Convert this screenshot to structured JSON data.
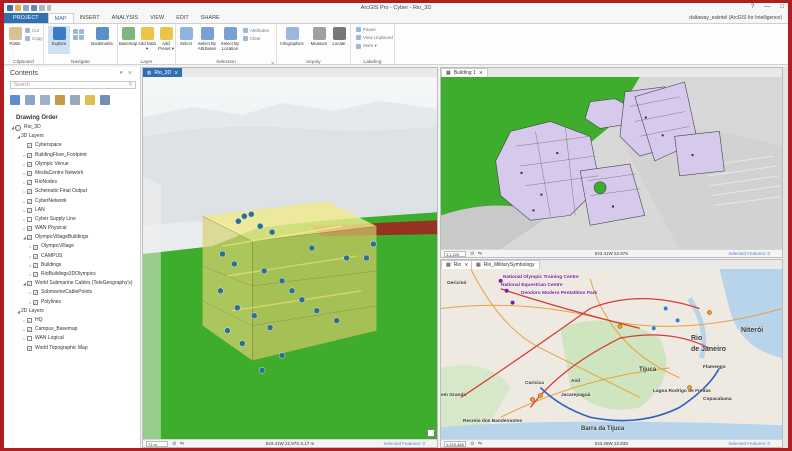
{
  "window": {
    "title": "ArcGIS Pro - Cyber - Rio_3D",
    "controls": [
      "?",
      "—",
      "□"
    ]
  },
  "quick_access": [
    "save-icon",
    "open-icon",
    "new-icon",
    "undo-icon",
    "redo-icon",
    "customize-icon"
  ],
  "ribbon_tabs": [
    "PROJECT",
    "MAP",
    "INSERT",
    "ANALYSIS",
    "VIEW",
    "EDIT",
    "SHARE"
  ],
  "active_tab": "MAP",
  "signin": "daltaway_esiintel (ArcGIS for Intelligence)",
  "ribbon": {
    "clipboard": {
      "name": "Clipboard",
      "paste": "Paste",
      "cut": "Cut",
      "copy": "Copy"
    },
    "navigate": {
      "name": "Navigate",
      "explore": "Explore",
      "bookmarks": "Bookmarks"
    },
    "layer": {
      "name": "Layer",
      "basemap": "Basemap",
      "add_data": "Add Data ▾",
      "add_preset": "Add Preset ▾"
    },
    "selection": {
      "name": "Selection",
      "select": "Select",
      "by_attributes": "Select By Attributes",
      "by_location": "Select By Location",
      "attributes": "Attributes",
      "clear": "Clear"
    },
    "inquiry": {
      "name": "Inquiry",
      "infographics": "Infographics",
      "measure": "Measure",
      "locate": "Locate"
    },
    "labeling": {
      "name": "Labeling",
      "pause": "Pause",
      "view_unplaced": "View Unplaced",
      "more": "More ▾"
    }
  },
  "contents": {
    "title": "Contents",
    "pin": "▾ ⨯",
    "search_placeholder": "Search",
    "drawing_order": "Drawing Order",
    "items": [
      {
        "label": "Rio_3D",
        "level": 0,
        "kind": "scene",
        "expand": "◢"
      },
      {
        "label": "3D Layers",
        "level": 1,
        "kind": "group",
        "expand": "◢"
      },
      {
        "label": "Cyberspace",
        "level": 2,
        "checked": true
      },
      {
        "label": "BuildingFloor_Footprint",
        "level": 2,
        "checked": true,
        "expand": "▹"
      },
      {
        "label": "Olympic Venue",
        "level": 2,
        "checked": true,
        "expand": "▹"
      },
      {
        "label": "MediaCentre Network",
        "level": 2,
        "checked": true,
        "expand": "▹"
      },
      {
        "label": "RioNodes",
        "level": 2,
        "checked": true,
        "expand": "▹"
      },
      {
        "label": "Schematic Final Output",
        "level": 2,
        "checked": true,
        "expand": "▹"
      },
      {
        "label": "CyberNetwork",
        "level": 2,
        "checked": true,
        "expand": "▹"
      },
      {
        "label": "LAN",
        "level": 2,
        "checked": true,
        "expand": "▹"
      },
      {
        "label": "Cyber Supply Line",
        "level": 2,
        "checked": false,
        "expand": "▹"
      },
      {
        "label": "WAN Physical",
        "level": 2,
        "checked": true,
        "expand": "▹"
      },
      {
        "label": "OlympicVillageBuildings",
        "level": 2,
        "checked": true,
        "expand": "◢"
      },
      {
        "label": "OlympicVillage",
        "level": 3,
        "checked": true,
        "expand": "▹"
      },
      {
        "label": "CAMPUS",
        "level": 3,
        "checked": true,
        "expand": "▹"
      },
      {
        "label": "Buildings",
        "level": 3,
        "checked": true,
        "expand": "▹"
      },
      {
        "label": "RioBuildings3DOlympics",
        "level": 3,
        "checked": true,
        "expand": "▹"
      },
      {
        "label": "World Submarine Cables (TeleGeography's)",
        "level": 2,
        "checked": true,
        "expand": "◢"
      },
      {
        "label": "SubmarineCablePoints",
        "level": 3,
        "checked": true,
        "expand": "▹"
      },
      {
        "label": "Polylines",
        "level": 3,
        "checked": true,
        "expand": "▹"
      },
      {
        "label": "2D Layers",
        "level": 1,
        "kind": "group",
        "expand": "◢"
      },
      {
        "label": "HQ",
        "level": 2,
        "checked": true,
        "expand": "▹"
      },
      {
        "label": "Campus_Basemap",
        "level": 2,
        "checked": true,
        "expand": "▹"
      },
      {
        "label": "WAN Logical",
        "level": 2,
        "checked": false,
        "expand": "▹"
      },
      {
        "label": "World Topographic Map",
        "level": 2,
        "checked": true,
        "expand": ""
      }
    ]
  },
  "views": {
    "scene": {
      "tab": "Rio_3D",
      "close": "⨯",
      "scale": "71 m",
      "coord": "043.41W 22.97S  6.17 m",
      "selected": "Selected Features: 0"
    },
    "building": {
      "tab": "Building 1",
      "close": "⨯",
      "scale": "1:1,220",
      "coord": "043.41W 22.97S",
      "selected": "Selected Features: 0"
    },
    "rio": {
      "tabs": [
        "Rio",
        "Rio_MilitarySymbology"
      ],
      "close": "⨯",
      "scale": "1:215,466",
      "coord": "043.29W 22.83S",
      "selected": "Selected Features: 0"
    }
  },
  "map_labels": {
    "purple": [
      "National Olympic Training Centre",
      "National Equestrian Centre",
      "Deodoro Modern Pentathlon Park"
    ],
    "places": [
      "Gericinó",
      "Niterói",
      "Rio",
      "de Janeiro",
      "Tijuca",
      "Anil",
      "Curicica",
      "Jacarepaguá",
      "Barra da Tijuca",
      "em Granda",
      "Recreio dos Bandeirantes",
      "Flamengo",
      "Copacabana",
      "Lagoa Rodrigo de Freitas"
    ]
  },
  "colors": {
    "frame": "#b01e22",
    "project_tab": "#2f6fb2",
    "terrain_green": "#3eac2c",
    "building_purple": "#d6c9ec",
    "glass_yellow": "#e8e27a"
  }
}
